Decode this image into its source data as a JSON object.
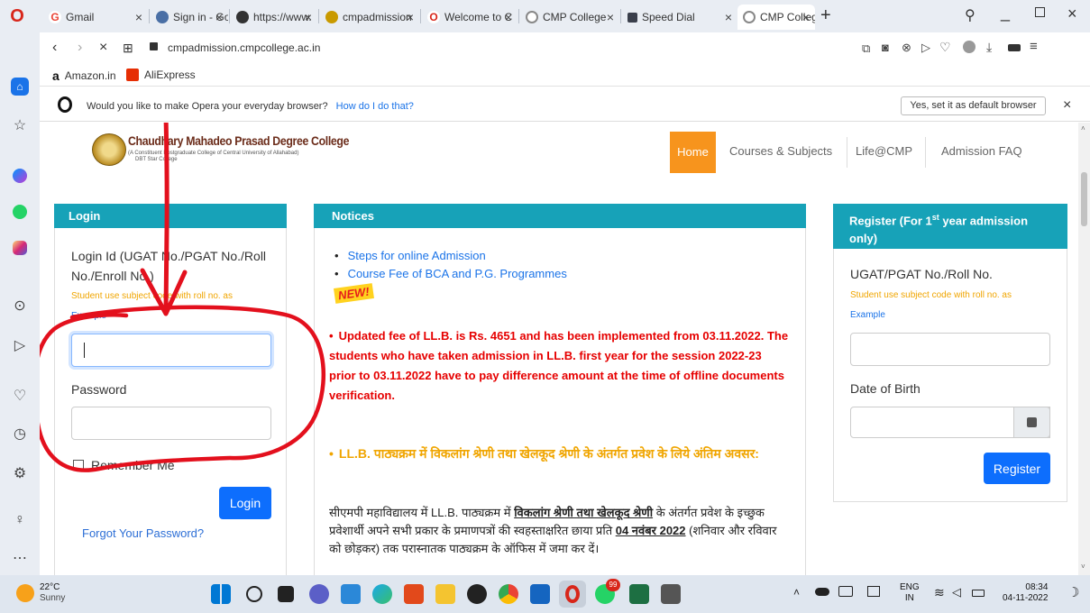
{
  "tabs": [
    {
      "label": "Gmail",
      "fav": "G",
      "color": "#ea4335"
    },
    {
      "label": "Sign in - Goo",
      "fav": "◉",
      "color": "#4a6fa5"
    },
    {
      "label": "https://www.",
      "fav": "◉",
      "color": "#333"
    },
    {
      "label": "cmpadmission",
      "fav": "◎",
      "color": "#c99a00"
    },
    {
      "label": "Welcome to C",
      "fav": "O",
      "color": "#d8261a"
    },
    {
      "label": "CMP College",
      "fav": "◌",
      "color": "#777"
    },
    {
      "label": "Speed Dial",
      "fav": "▦",
      "color": "#3a3f4b"
    },
    {
      "label": "CMP College",
      "fav": "◌",
      "color": "#777"
    }
  ],
  "address": {
    "url": "cmpadmission.cmpcollege.ac.in"
  },
  "bookmarks": [
    {
      "label": "Amazon.in"
    },
    {
      "label": "AliExpress"
    }
  ],
  "opera_prompt": {
    "question": "Would you like to make Opera your everyday browser?",
    "link": "How do I do that?",
    "button": "Yes, set it as default browser",
    "close": "×"
  },
  "site": {
    "logo_title": "Chaudhary Mahadeo Prasad Degree College",
    "logo_sub1": "(A Constituent Postgraduate College of Central University of Allahabad)",
    "logo_sub2": "DBT Star College",
    "nav": [
      "Home",
      "Courses & Subjects",
      "Life@CMP",
      "Admission FAQ"
    ]
  },
  "login": {
    "title": "Login",
    "id_label": "Login Id (UGAT No./PGAT No./Roll No./Enroll No.)",
    "hint": "Student use subject code with roll no. as",
    "example": "Example",
    "password_label": "Password",
    "remember": "Remember Me",
    "button": "Login",
    "forgot": "Forgot Your Password?"
  },
  "notices": {
    "title": "Notices",
    "items": [
      "Steps for online Admission",
      "Course Fee of BCA and P.G. Programmes"
    ],
    "new_badge": "NEW!",
    "red_notice": "Updated fee of LL.B. is Rs. 4651 and has been implemented from 03.11.2022. The students who have taken admission in LL.B. first year for the session 2022-23 prior to 03.11.2022 have to pay difference amount at the time of offline documents verification.",
    "orange_notice": "LL.B. पाठ्यक्रम में विकलांग श्रेणी तथा खेलकूद श्रेणी के अंतर्गत प्रवेश के लिये अंतिम अवसर:",
    "hindi_pre": "सीएमपी महाविद्यालय में LL.B. पाठ्यक्रम में ",
    "hindi_bold": "विकलांग श्रेणी तथा खेलकूद श्रेणी",
    "hindi_mid": " के अंतर्गत प्रवेश के इच्छुक प्रवेशार्थी अपने सभी प्रकार के प्रमाणपत्रों की स्वहस्ताक्षरित छाया प्रति ",
    "hindi_date": "04 नवंबर 2022",
    "hindi_post": " (शनिवार और रविवार को छोड़कर) तक परास्नातक पाठ्यक्रम के ऑफिस में जमा कर दें।"
  },
  "register": {
    "title_pre": "Register (For 1",
    "title_sup": "st",
    "title_post": " year admission only)",
    "id_label": "UGAT/PGAT No./Roll No.",
    "hint": "Student use subject code with roll no. as",
    "example": "Example",
    "dob_label": "Date of Birth",
    "button": "Register"
  },
  "taskbar": {
    "temp": "22°C",
    "weather": "Sunny",
    "lang1": "ENG",
    "lang2": "IN",
    "time": "08:34",
    "date": "04-11-2022",
    "badge": "99"
  },
  "colors": {
    "teal": "#17a2b8",
    "orange": "#f7941d",
    "annotation": "#e3101d",
    "primary": "#0d6efd"
  }
}
